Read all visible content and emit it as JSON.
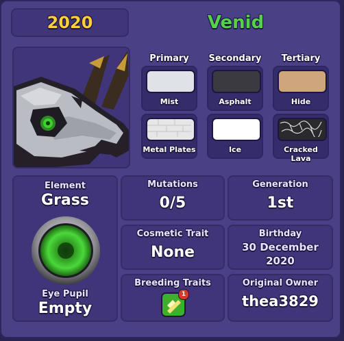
{
  "header": {
    "year": "2020",
    "species": "Venid"
  },
  "colors": {
    "headers": {
      "primary": "Primary",
      "secondary": "Secondary",
      "tertiary": "Tertiary"
    },
    "swatches": [
      {
        "name": "Mist",
        "color": "#dfe2e6"
      },
      {
        "name": "Asphalt",
        "color": "#3b3a40"
      },
      {
        "name": "Hide",
        "color": "#cfa57c"
      },
      {
        "name": "Metal Plates",
        "color": "#e6e6e6"
      },
      {
        "name": "Ice",
        "color": "#ffffff"
      },
      {
        "name": "Cracked Lava",
        "color": "#2a2a2e"
      }
    ]
  },
  "element": {
    "label": "Element",
    "value": "Grass"
  },
  "eye_pupil": {
    "label": "Eye Pupil",
    "value": "Empty"
  },
  "mutations": {
    "label": "Mutations",
    "value": "0/5"
  },
  "generation": {
    "label": "Generation",
    "value": "1st"
  },
  "cosmetic_trait": {
    "label": "Cosmetic Trait",
    "value": "None"
  },
  "birthday": {
    "label": "Birthday",
    "date": "30 December",
    "year": "2020"
  },
  "breeding_traits": {
    "label": "Breeding Traits",
    "badge_count": "1"
  },
  "original_owner": {
    "label": "Original Owner",
    "value": "thea3829"
  },
  "icons": {
    "element_orb": "grass-eye-orb-icon",
    "breeding_badge": "breeding-trait-icon"
  }
}
